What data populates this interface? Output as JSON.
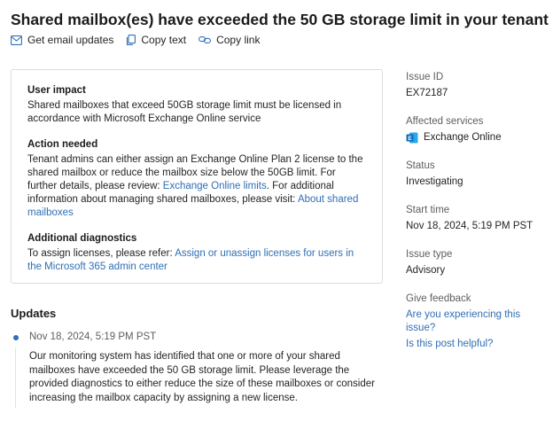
{
  "title": "Shared mailbox(es) have exceeded the 50 GB storage limit in your tenant",
  "actions": {
    "email_updates": "Get email updates",
    "copy_text": "Copy text",
    "copy_link": "Copy link"
  },
  "card": {
    "user_impact": {
      "heading": "User impact",
      "text": "Shared mailboxes that exceed 50GB storage limit must be licensed in accordance with Microsoft Exchange Online service"
    },
    "action_needed": {
      "heading": "Action needed",
      "text_1": "Tenant admins can either assign an Exchange Online Plan 2 license to the shared mailbox or reduce the mailbox size below the 50GB limit. For further details, please review: ",
      "link_1": "Exchange Online limits",
      "text_2": ". For additional information about managing shared mailboxes, please visit: ",
      "link_2": "About shared mailboxes"
    },
    "diagnostics": {
      "heading": "Additional diagnostics",
      "text": "To assign licenses, please refer: ",
      "link": "Assign or unassign licenses for users in the Microsoft 365 admin center"
    }
  },
  "side": {
    "issue_id_label": "Issue ID",
    "issue_id": "EX72187",
    "affected_label": "Affected services",
    "affected": "Exchange Online",
    "status_label": "Status",
    "status": "Investigating",
    "start_label": "Start time",
    "start": "Nov 18, 2024, 5:19 PM PST",
    "type_label": "Issue type",
    "type": "Advisory",
    "feedback_label": "Give feedback",
    "feedback_q1": "Are you experiencing this issue?",
    "feedback_q2": "Is this post helpful?"
  },
  "updates": {
    "heading": "Updates",
    "items": [
      {
        "time": "Nov 18, 2024, 5:19 PM PST",
        "text": "Our monitoring system has identified that one or more of your shared mailboxes have exceeded the 50 GB storage limit. Please leverage the provided diagnostics to either reduce the size of these mailboxes or consider increasing the mailbox capacity by assigning a new license."
      }
    ]
  },
  "colors": {
    "link": "#2f6fb5",
    "exchange_icon": "#0f6cbd"
  }
}
